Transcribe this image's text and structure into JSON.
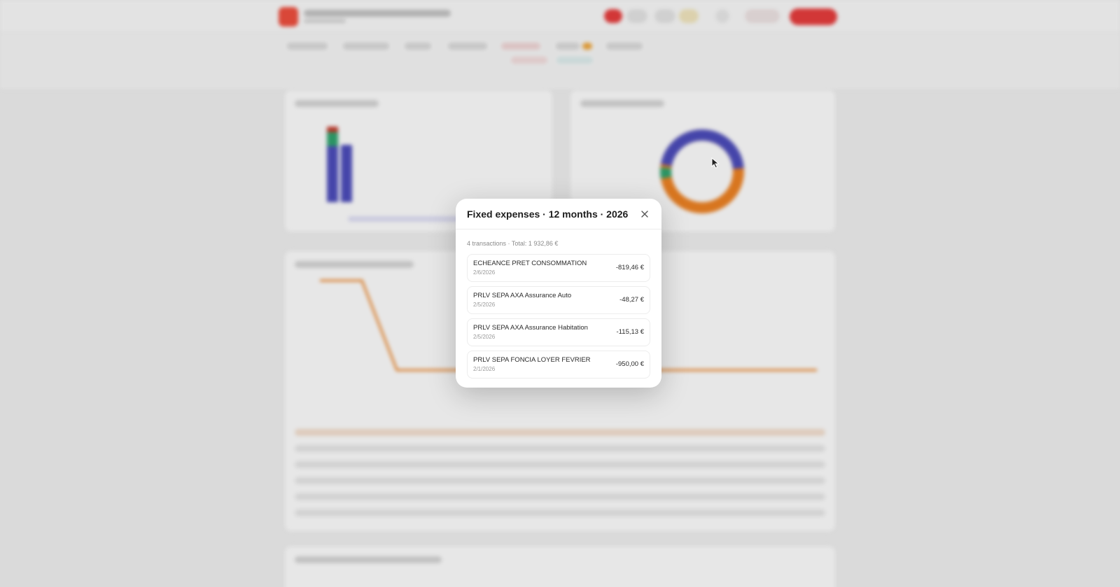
{
  "modal": {
    "title": "Fixed expenses · 12 months · 2026",
    "summary": "4 transactions · Total: 1 932,86 €",
    "transactions": [
      {
        "label": "ECHEANCE PRET CONSOMMATION",
        "date": "2/6/2026",
        "amount": "-819,46 €"
      },
      {
        "label": "PRLV SEPA AXA Assurance Auto",
        "date": "2/5/2026",
        "amount": "-48,27 €"
      },
      {
        "label": "PRLV SEPA AXA Assurance Habitation",
        "date": "2/5/2026",
        "amount": "-115,13 €"
      },
      {
        "label": "PRLV SEPA FONCIA LOYER FEVRIER",
        "date": "2/1/2026",
        "amount": "-950,00 €"
      }
    ]
  },
  "colors": {
    "brand": "#e74c3c",
    "bar_primary": "#4a4ab5",
    "bar_secondary": "#2e9e6b",
    "donut_blue": "#4a4ab5",
    "donut_orange": "#e67e22",
    "line_orange": "#e67e22"
  },
  "icons": {
    "close": "close-icon",
    "cursor": "mouse-cursor-icon"
  }
}
